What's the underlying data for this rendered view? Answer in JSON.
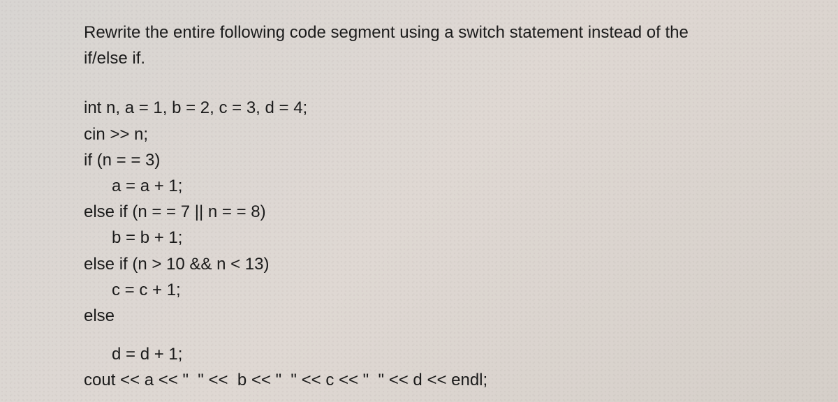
{
  "prompt": {
    "line1": "Rewrite the entire following code segment using a switch statement instead of the",
    "line2": "if/else if."
  },
  "code": {
    "l1": "int n, a = 1, b = 2, c = 3, d = 4;",
    "l2": "cin >> n;",
    "l3": "if (n = = 3)",
    "l4": "a = a + 1;",
    "l5": "else if (n = = 7 || n = = 8)",
    "l6": "b = b + 1;",
    "l7": "else if (n > 10 && n < 13)",
    "l8": "c = c + 1;",
    "l9": "else",
    "l10": "d = d + 1;",
    "l11": "cout << a << \"  \" <<  b << \"  \" << c << \"  \" << d << endl;"
  }
}
